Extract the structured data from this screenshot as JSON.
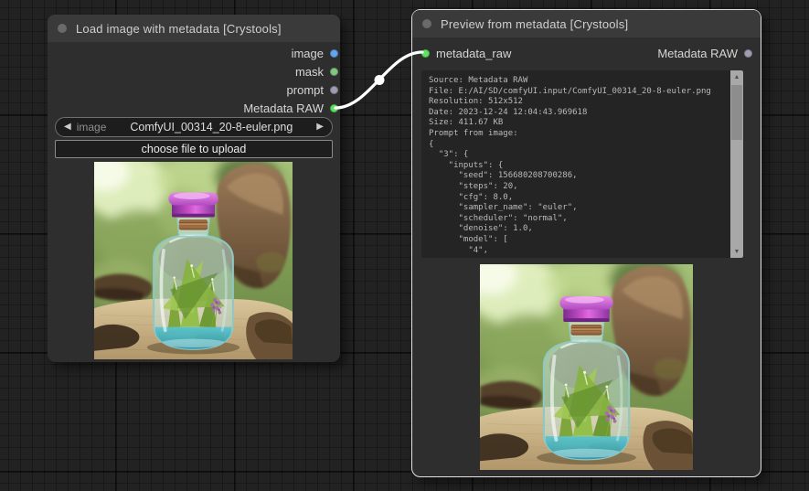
{
  "link": {
    "color": "#ffffff"
  },
  "icons": {
    "arrow_left": "◀",
    "arrow_right": "▶",
    "scroll_up": "▲",
    "scroll_down": "▼"
  },
  "load_node": {
    "title": "Load image with metadata [Crystools]",
    "outputs": [
      {
        "label": "image",
        "color": "#64a5f0"
      },
      {
        "label": "mask",
        "color": "#81c784"
      },
      {
        "label": "prompt",
        "color": "#9e9eb3"
      },
      {
        "label": "Metadata RAW",
        "color": "#5fe35f"
      }
    ],
    "combo": {
      "label": "image",
      "value": "ComfyUI_00314_20-8-euler.png"
    },
    "upload_button": "choose file to upload"
  },
  "preview_node": {
    "title": "Preview from metadata [Crystools]",
    "input": {
      "label": "metadata_raw",
      "color": "#5fe35f"
    },
    "output": {
      "label": "Metadata RAW",
      "color": "#9e9eb3"
    },
    "metadata_lines": [
      "Source: Metadata RAW",
      "File: E:/AI/SD/comfyUI.input/ComfyUI_00314_20-8-euler.png",
      "Resolution: 512x512",
      "Date: 2023-12-24 12:04:43.969618",
      "Size: 411.67 KB",
      "Prompt from image:",
      "{",
      "  \"3\": {",
      "    \"inputs\": {",
      "      \"seed\": 156680208700286,",
      "      \"steps\": 20,",
      "      \"cfg\": 8.0,",
      "      \"sampler_name\": \"euler\",",
      "      \"scheduler\": \"normal\",",
      "      \"denoise\": 1.0,",
      "      \"model\": [",
      "        \"4\","
    ]
  }
}
